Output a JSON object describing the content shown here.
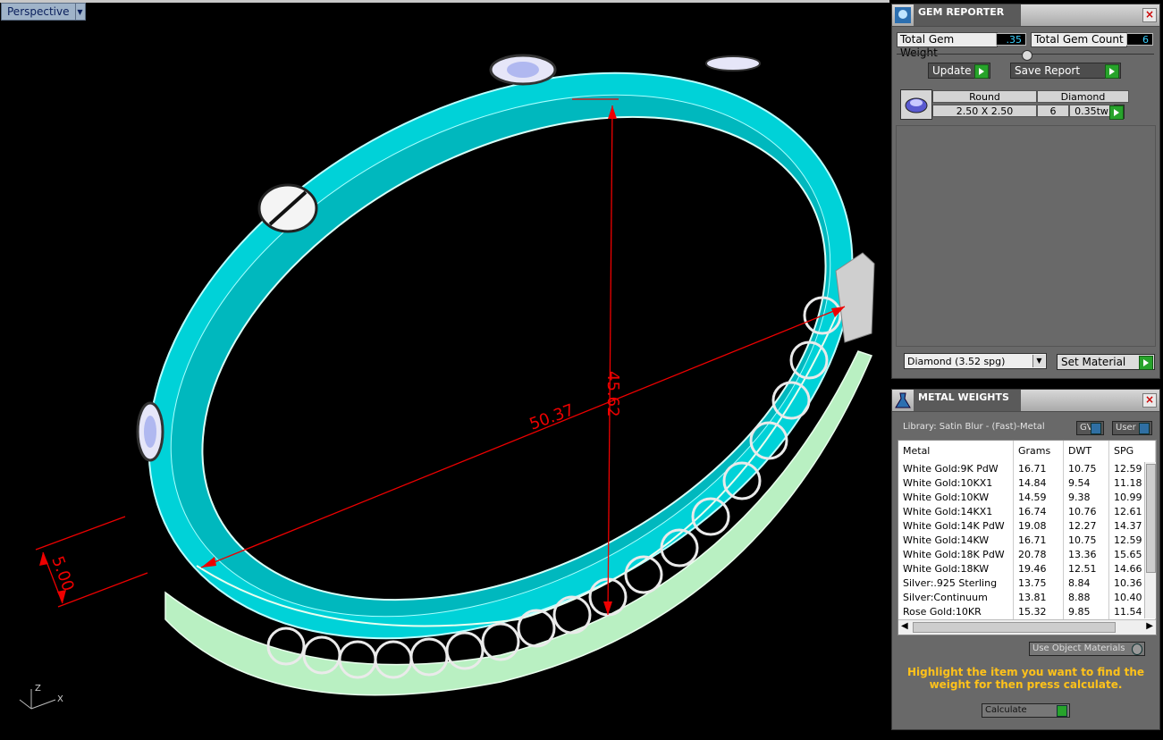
{
  "viewport": {
    "tab_label": "Perspective",
    "dimensions": [
      "50.37",
      "45.62",
      "5.00"
    ],
    "axis": {
      "z": "Z",
      "x": "X"
    }
  },
  "gem_reporter": {
    "title": "GEM REPORTER",
    "total_weight_label": "Total Gem Weight",
    "total_weight": ".35",
    "total_count_label": "Total Gem Count",
    "total_count": "6",
    "update_label": "Update",
    "save_label": "Save Report",
    "gem": {
      "shape": "Round",
      "type": "Diamond",
      "size": "2.50 X 2.50",
      "count": "6",
      "weight": "0.35tw"
    },
    "material_select": "Diamond     (3.52 spg)",
    "set_material_label": "Set Material"
  },
  "metal_weights": {
    "title": "METAL WEIGHTS",
    "library": "Library: Satin Blur - (Fast)-Metal",
    "gv_label": "GV",
    "user_label": "User",
    "columns": [
      "Metal",
      "Grams",
      "DWT",
      "SPG"
    ],
    "rows": [
      [
        "White Gold:9K PdW",
        "16.71",
        "10.75",
        "12.59"
      ],
      [
        "White Gold:10KX1",
        "14.84",
        "9.54",
        "11.18"
      ],
      [
        "White Gold:10KW",
        "14.59",
        "9.38",
        "10.99"
      ],
      [
        "White Gold:14KX1",
        "16.74",
        "10.76",
        "12.61"
      ],
      [
        "White Gold:14K PdW",
        "19.08",
        "12.27",
        "14.37"
      ],
      [
        "White Gold:14KW",
        "16.71",
        "10.75",
        "12.59"
      ],
      [
        "White Gold:18K PdW",
        "20.78",
        "13.36",
        "15.65"
      ],
      [
        "White Gold:18KW",
        "19.46",
        "12.51",
        "14.66"
      ],
      [
        "Silver:.925 Sterling",
        "13.75",
        "8.84",
        "10.36"
      ],
      [
        "Silver:Continuum",
        "13.81",
        "8.88",
        "10.40"
      ],
      [
        "Rose Gold:10KR",
        "15.32",
        "9.85",
        "11.54"
      ]
    ],
    "use_object_materials": "Use Object Materials",
    "hint": "Highlight the item you want to find the weight for then press calculate.",
    "calculate_label": "Calculate"
  }
}
